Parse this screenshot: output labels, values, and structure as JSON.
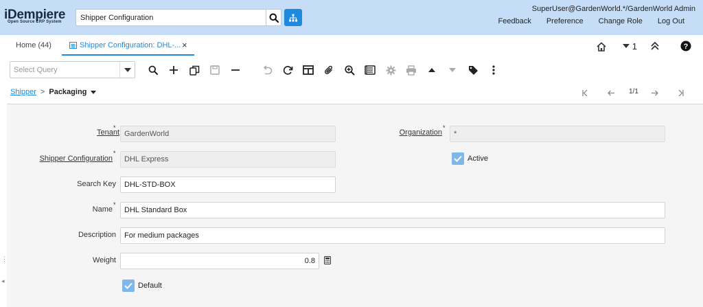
{
  "app": {
    "logo_text": "iDempiere",
    "logo_subtitle": "Open Source ERP System",
    "search_value": "Shipper Configuration",
    "user": "SuperUser@GardenWorld.*/GardenWorld Admin",
    "links": [
      "Feedback",
      "Preference",
      "Change Role",
      "Log Out"
    ]
  },
  "tabs": {
    "home": "Home (44)",
    "active": "Shipper Configuration: DHL-...",
    "close": "×",
    "count": "1"
  },
  "toolbar": {
    "query_placeholder": "Select Query",
    "buttons": [
      "search-icon",
      "new-icon",
      "copy-icon",
      "save-icon",
      "delete-icon",
      "undo-icon",
      "refresh-icon",
      "grid-toggle-icon",
      "attachment-icon",
      "zoom-icon",
      "report-icon",
      "process-icon",
      "print-icon",
      "parent-record-icon",
      "detail-record-icon",
      "tag-icon",
      "more-icon"
    ]
  },
  "breadcrumb": {
    "parent": "Shipper",
    "separator": ">",
    "current": "Packaging"
  },
  "record_nav": {
    "position": "1/1"
  },
  "form": {
    "tenant_label": "Tenant",
    "tenant_value": "GardenWorld",
    "org_label": "Organization",
    "org_value": "*",
    "shipper_config_label": "Shipper Configuration",
    "shipper_config_value": "DHL Express",
    "active_label": "Active",
    "active_checked": true,
    "search_key_label": "Search Key",
    "search_key_value": "DHL-STD-BOX",
    "name_label": "Name",
    "name_value": "DHL Standard Box",
    "description_label": "Description",
    "description_value": "For medium packages",
    "weight_label": "Weight",
    "weight_value": "0.8",
    "default_label": "Default",
    "default_checked": true,
    "required_mark": "*"
  },
  "colors": {
    "header_bg": "#c5ddf7",
    "accent": "#1d8ae0",
    "checkbox": "#7fb8e8"
  }
}
